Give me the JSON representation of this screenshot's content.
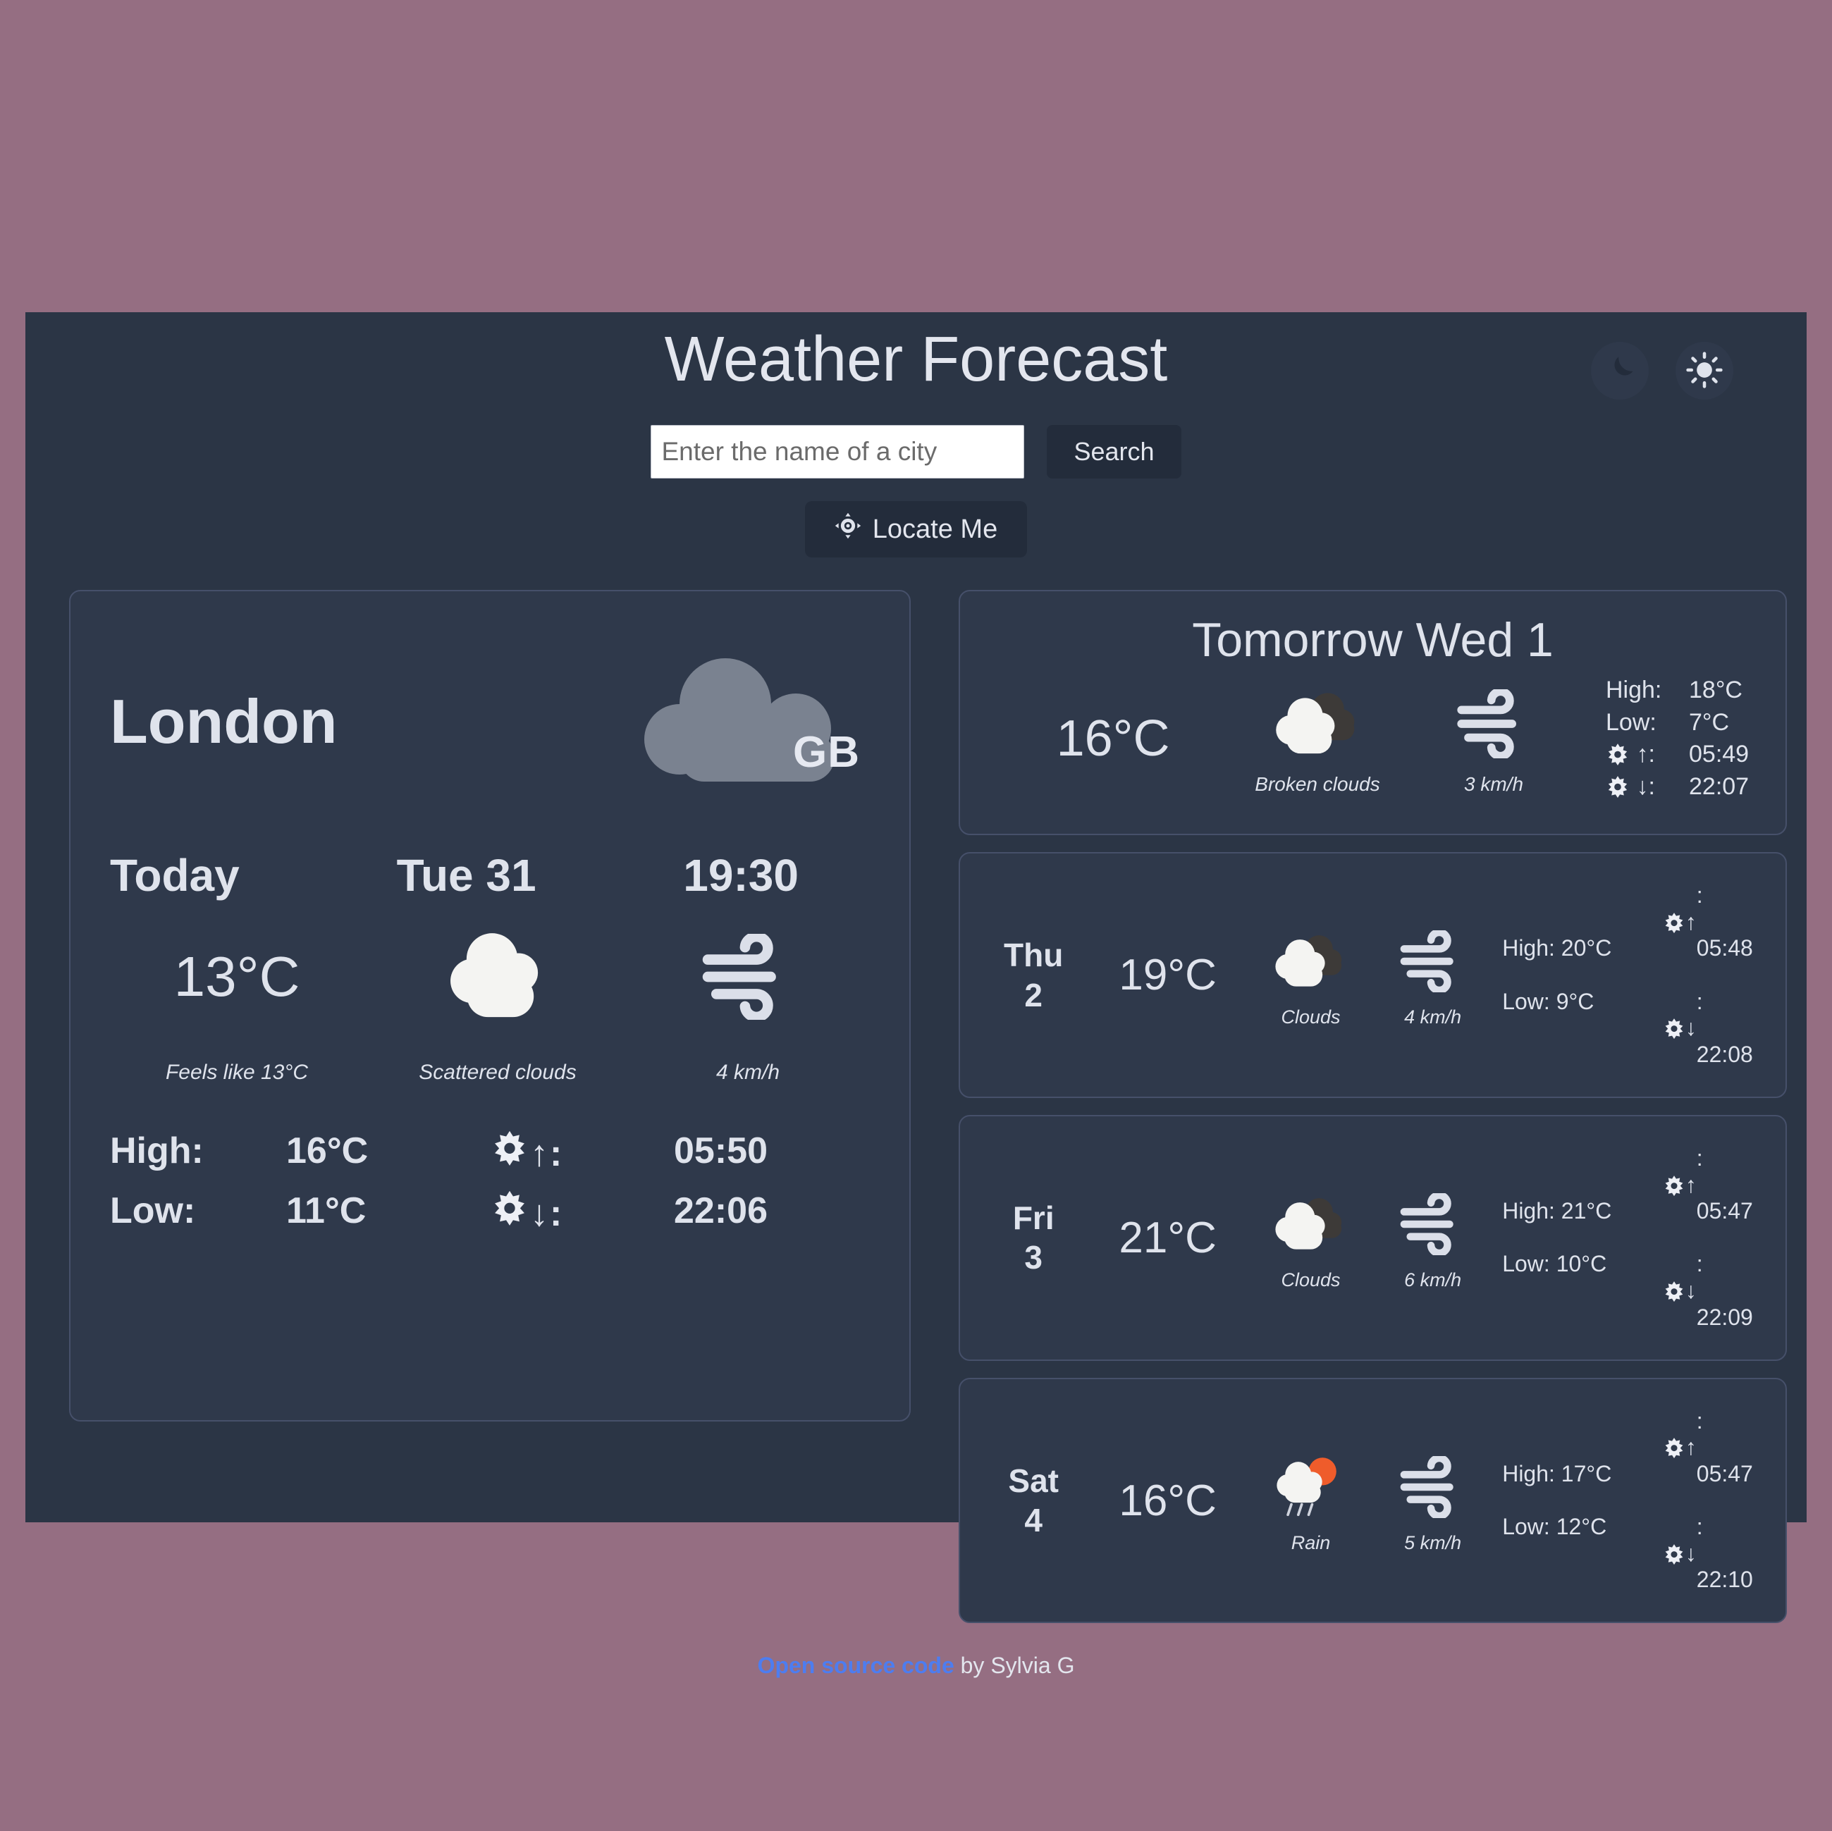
{
  "header": {
    "title": "Weather Forecast",
    "dark_toggle_icon": "moon-icon",
    "light_toggle_icon": "sun-icon"
  },
  "search": {
    "placeholder": "Enter the name of a city",
    "value": "",
    "button_label": "Search",
    "locate_label": "Locate Me",
    "locate_icon": "crosshair-location-icon"
  },
  "current": {
    "city": "London",
    "country_code": "GB",
    "country_icon": "cloud-icon",
    "day_label": "Today",
    "date_label": "Tue  31",
    "time": "19:30",
    "temperature": "13°C",
    "feels_like": "Feels like 13°C",
    "condition": "Scattered clouds",
    "condition_icon": "cloud-white-icon",
    "wind": "4 km/h",
    "wind_icon": "wind-icon",
    "high_label": "High:",
    "high_value": "16°C",
    "low_label": "Low:",
    "low_value": "11°C",
    "sunrise_label": ":",
    "sunrise_icon": "sunrise-icon",
    "sunrise_value": "05:50",
    "sunset_label": ":",
    "sunset_icon": "sunset-icon",
    "sunset_value": "22:06"
  },
  "tomorrow": {
    "title": "Tomorrow  Wed  1",
    "temperature": "16°C",
    "condition": "Broken clouds",
    "condition_icon": "broken-clouds-icon",
    "wind": "3 km/h",
    "wind_icon": "wind-icon",
    "high_label": "High:",
    "high_value": "18°C",
    "low_label": "Low:",
    "low_value": "7°C",
    "sunrise_icon": "sunrise-icon",
    "sunrise_label": ":",
    "sunrise_value": "05:49",
    "sunset_icon": "sunset-icon",
    "sunset_label": ":",
    "sunset_value": "22:07"
  },
  "days": [
    {
      "weekday": "Thu",
      "daynum": "2",
      "temperature": "19°C",
      "condition": "Clouds",
      "condition_icon": "clouds-icon",
      "wind": "4 km/h",
      "wind_icon": "wind-icon",
      "high": "High: 20°C",
      "low": "Low: 9°C",
      "sunrise_icon": "sunrise-icon",
      "sunrise": ": 05:48",
      "sunset_icon": "sunset-icon",
      "sunset": ": 22:08"
    },
    {
      "weekday": "Fri",
      "daynum": "3",
      "temperature": "21°C",
      "condition": "Clouds",
      "condition_icon": "clouds-icon",
      "wind": "6 km/h",
      "wind_icon": "wind-icon",
      "high": "High: 21°C",
      "low": "Low: 10°C",
      "sunrise_icon": "sunrise-icon",
      "sunrise": ": 05:47",
      "sunset_icon": "sunset-icon",
      "sunset": ": 22:09"
    },
    {
      "weekday": "Sat",
      "daynum": "4",
      "temperature": "16°C",
      "condition": "Rain",
      "condition_icon": "rain-icon",
      "wind": "5 km/h",
      "wind_icon": "wind-icon",
      "high": "High: 17°C",
      "low": "Low: 12°C",
      "sunrise_icon": "sunrise-icon",
      "sunrise": ": 05:47",
      "sunset_icon": "sunset-icon",
      "sunset": ": 22:10"
    }
  ],
  "footer": {
    "link_text": "Open source code",
    "byline": " by Sylvia G"
  },
  "colors": {
    "page_background": "#956e82",
    "app_background": "#2b3545",
    "card_background": "#2f394b",
    "card_border": "#46506a",
    "text": "#dfe3ec",
    "link": "#4d7df0",
    "cloud_gray": "#7a8290",
    "cloud_white": "#f4f4f2",
    "cloud_dark": "#3d3a38",
    "sun_orange": "#ef5c2b"
  }
}
